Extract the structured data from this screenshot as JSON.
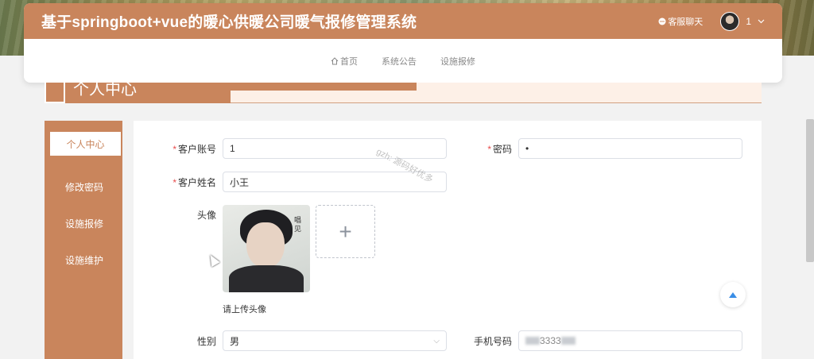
{
  "header": {
    "title": "基于springboot+vue的暖心供暖公司暖气报修管理系统",
    "service_label": "客服聊天",
    "user_name": "1",
    "user_dropdown_icon": "chevron-down-icon"
  },
  "nav": {
    "items": [
      {
        "label": "首页",
        "icon": "home-icon"
      },
      {
        "label": "系统公告"
      },
      {
        "label": "设施报修"
      }
    ]
  },
  "page": {
    "title": "个人中心"
  },
  "sidebar": {
    "items": [
      {
        "label": "个人中心",
        "active": true
      },
      {
        "label": "修改密码"
      },
      {
        "label": "设施报修"
      },
      {
        "label": "设施维护"
      }
    ]
  },
  "form": {
    "account_label": "客户账号",
    "account_value": "1",
    "password_label": "密码",
    "password_value": "•",
    "name_label": "客户姓名",
    "name_value": "小王",
    "avatar_label": "头像",
    "avatar_poster_text": "唱见",
    "upload_plus": "+",
    "upload_tip": "请上传头像",
    "gender_label": "性别",
    "gender_value": "男",
    "phone_label": "手机号码",
    "phone_value_visible": "3333",
    "required_mark": "*"
  },
  "watermark": "gzh: 源码好优多",
  "colors": {
    "primary": "#c9855c",
    "light_bg": "#fdf0e7",
    "required": "#e84d4d",
    "back_top_icon": "#3a8ee6"
  }
}
